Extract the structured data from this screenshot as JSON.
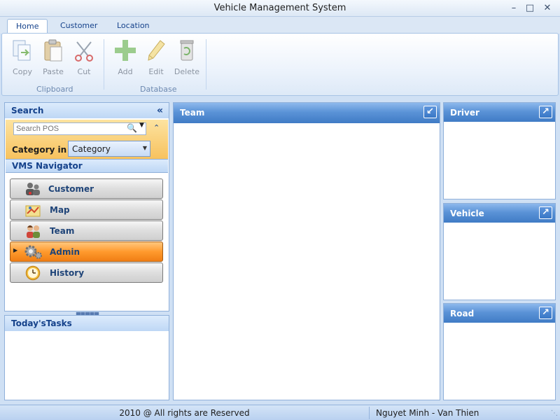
{
  "window": {
    "title": "Vehicle Management System",
    "controls": [
      "minimize-icon",
      "maximize-icon",
      "close-icon"
    ]
  },
  "ribbon": {
    "tabs": [
      {
        "label": "Home",
        "active": true
      },
      {
        "label": "Customer",
        "active": false
      },
      {
        "label": "Location",
        "active": false
      }
    ],
    "groups": {
      "clipboard": {
        "label": "Clipboard",
        "buttons": [
          {
            "label": "Copy",
            "icon": "copy-icon"
          },
          {
            "label": "Paste",
            "icon": "paste-icon"
          },
          {
            "label": "Cut",
            "icon": "cut-icon"
          }
        ]
      },
      "database": {
        "label": "Database",
        "buttons": [
          {
            "label": "Add",
            "icon": "add-icon"
          },
          {
            "label": "Edit",
            "icon": "edit-icon"
          },
          {
            "label": "Delete",
            "icon": "delete-icon"
          }
        ]
      }
    }
  },
  "search": {
    "title": "Search",
    "collapse_glyph": "«",
    "placeholder": "Search POS",
    "category_label": "Category in",
    "category_value": "Category"
  },
  "navigator": {
    "title": "VMS Navigator",
    "items": [
      {
        "label": "Customer",
        "icon": "customers-icon",
        "active": false
      },
      {
        "label": "Map",
        "icon": "map-icon",
        "active": false
      },
      {
        "label": "Team",
        "icon": "team-icon",
        "active": true
      },
      {
        "label": "Admin",
        "icon": "admin-gears-icon",
        "active": true
      },
      {
        "label": "History",
        "icon": "history-clock-icon",
        "active": false
      }
    ]
  },
  "tasks": {
    "title": "Today'sTasks"
  },
  "panels": {
    "team": "Team",
    "driver": "Driver",
    "vehicle": "Vehicle",
    "road": "Road"
  },
  "status": {
    "left": "2010 @ All rights are Reserved",
    "right": "Nguyet  Minh - Van Thien"
  },
  "colors": {
    "accent_blue": "#3f7bc5",
    "active_orange": "#ff9a2e",
    "frame": "#cfe0f4"
  }
}
